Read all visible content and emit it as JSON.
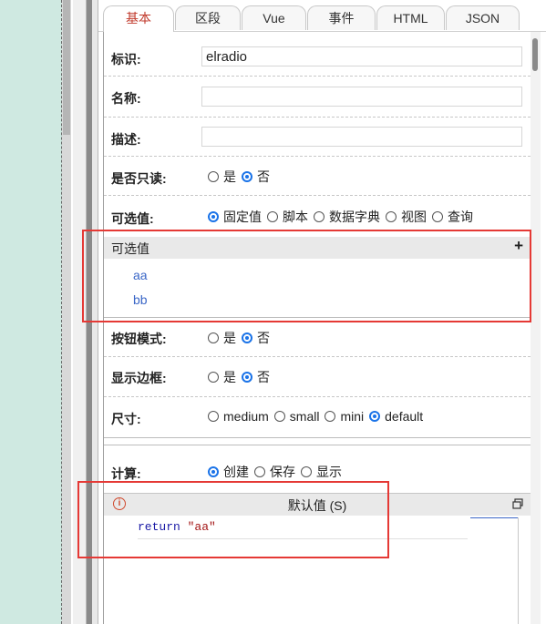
{
  "tabs": [
    {
      "label": "基本",
      "active": true
    },
    {
      "label": "区段",
      "active": false
    },
    {
      "label": "Vue",
      "active": false
    },
    {
      "label": "事件",
      "active": false
    },
    {
      "label": "HTML",
      "active": false
    },
    {
      "label": "JSON",
      "active": false
    }
  ],
  "fields": {
    "identifier": {
      "label": "标识:",
      "value": "elradio"
    },
    "name": {
      "label": "名称:",
      "value": ""
    },
    "description": {
      "label": "描述:",
      "value": ""
    },
    "readonly": {
      "label": "是否只读:",
      "options": [
        "是",
        "否"
      ],
      "selected": "否"
    },
    "options_source": {
      "label": "可选值:",
      "options": [
        "固定值",
        "脚本",
        "数据字典",
        "视图",
        "查询"
      ],
      "selected": "固定值"
    },
    "button_mode": {
      "label": "按钮模式:",
      "options": [
        "是",
        "否"
      ],
      "selected": "否"
    },
    "show_border": {
      "label": "显示边框:",
      "options": [
        "是",
        "否"
      ],
      "selected": "否"
    },
    "size": {
      "label": "尺寸:",
      "options": [
        "medium",
        "small",
        "mini",
        "default"
      ],
      "selected": "default"
    },
    "compute": {
      "label": "计算:",
      "options": [
        "创建",
        "保存",
        "显示"
      ],
      "selected": "创建"
    }
  },
  "options_section": {
    "title": "可选值",
    "add_icon": "plus-icon",
    "items": [
      "aa",
      "bb"
    ]
  },
  "default_value": {
    "title": "默认值 (S)",
    "info_icon": "info-icon",
    "restore_icon": "restore-window-icon",
    "code_keyword": "return",
    "code_string": "\"aa\""
  },
  "colors": {
    "active_tab_text": "#c0392b",
    "radio_selected": "#1a73e8",
    "option_item": "#3b67c7",
    "highlight_box": "#e53935",
    "left_panel_bg": "#cfe9e1"
  }
}
